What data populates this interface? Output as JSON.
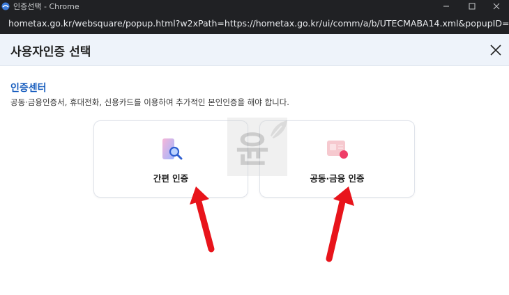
{
  "window": {
    "title": "인증선택 - Chrome"
  },
  "address_bar": {
    "url": "hometax.go.kr/websquare/popup.html?w2xPath=https://hometax.go.kr/ui/comm/a/b/UTECMABA14.xml&popupID=mf_txppWfram..."
  },
  "modal": {
    "title": "사용자인증 선택",
    "section_title": "인증센터",
    "description": "공동·금융인증서, 휴대전화, 신용카드를 이용하여 추가적인 본인인증을 해야 합니다.",
    "options": [
      {
        "label": "간편 인증",
        "icon": "phone-search-icon"
      },
      {
        "label": "공동·금융 인증",
        "icon": "certificate-card-icon"
      }
    ]
  },
  "watermark": {
    "text": "윤"
  },
  "colors": {
    "accent": "#1a5fbf",
    "annotation_arrow": "#e8141b",
    "header_bg": "#eef3fa"
  }
}
